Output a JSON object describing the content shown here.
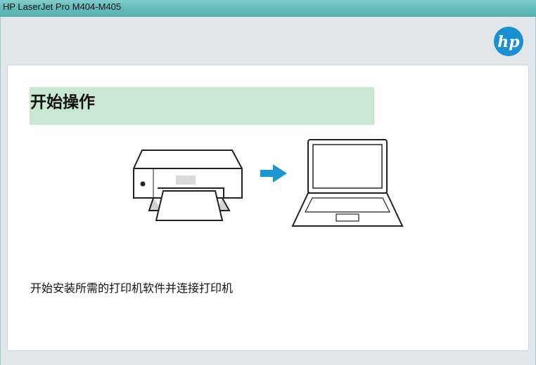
{
  "window": {
    "title": "HP LaserJet Pro M404-M405"
  },
  "branding": {
    "logo_text": "hp",
    "logo_color": "#1a8fd1"
  },
  "content": {
    "heading": "开始操作",
    "heading_bg": "#c9e8d2",
    "description": "开始安装所需的打印机软件并连接打印机",
    "illustration": {
      "left_icon": "printer-icon",
      "middle_icon": "arrow-right-icon",
      "right_icon": "laptop-icon",
      "arrow_color": "#1a98d5"
    }
  }
}
